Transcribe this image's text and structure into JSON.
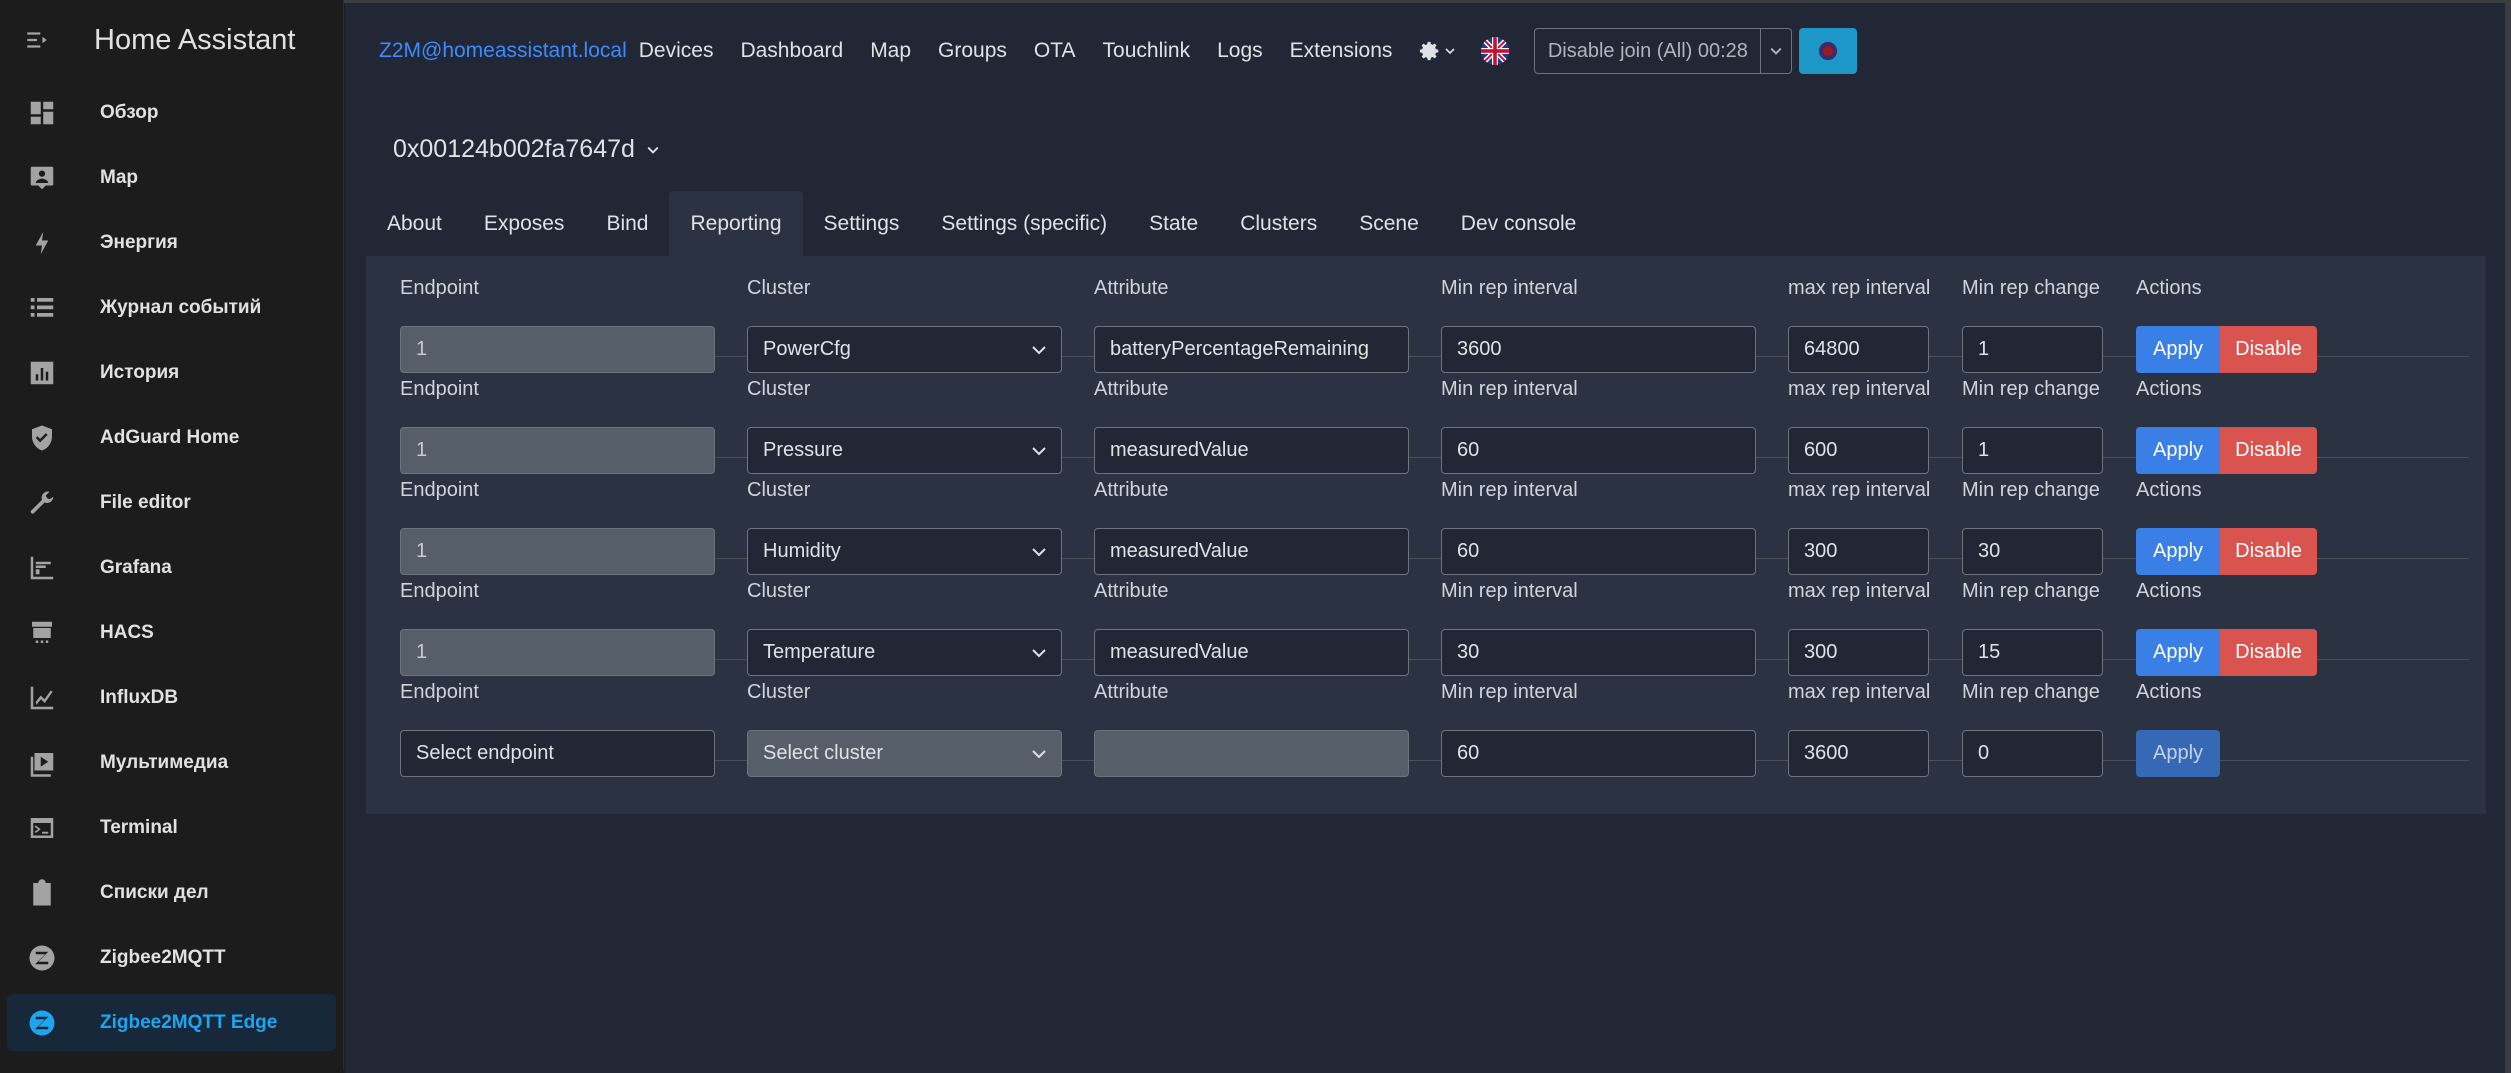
{
  "sidebar": {
    "title": "Home Assistant",
    "items": [
      {
        "label": "Обзор",
        "icon": "dashboard-icon"
      },
      {
        "label": "Map",
        "icon": "map-icon"
      },
      {
        "label": "Энергия",
        "icon": "lightning-icon"
      },
      {
        "label": "Журнал событий",
        "icon": "logbook-icon"
      },
      {
        "label": "История",
        "icon": "history-icon"
      },
      {
        "label": "AdGuard Home",
        "icon": "shield-icon"
      },
      {
        "label": "File editor",
        "icon": "wrench-icon"
      },
      {
        "label": "Grafana",
        "icon": "grafana-icon"
      },
      {
        "label": "HACS",
        "icon": "hacs-icon"
      },
      {
        "label": "InfluxDB",
        "icon": "chart-line-icon"
      },
      {
        "label": "Мультимедиа",
        "icon": "media-icon"
      },
      {
        "label": "Terminal",
        "icon": "terminal-icon"
      },
      {
        "label": "Списки дел",
        "icon": "todo-icon"
      },
      {
        "label": "Zigbee2MQTT",
        "icon": "zigbee-icon"
      },
      {
        "label": "Zigbee2MQTT Edge",
        "icon": "zigbee-icon",
        "active": true
      }
    ]
  },
  "topnav": {
    "brand": "Z2M@homeassistant.local",
    "links": [
      "Devices",
      "Dashboard",
      "Map",
      "Groups",
      "OTA",
      "Touchlink",
      "Logs",
      "Extensions"
    ],
    "join_label": "Disable join (All) 00:28"
  },
  "device": {
    "title": "0x00124b002fa7647d"
  },
  "tabs": [
    "About",
    "Exposes",
    "Bind",
    "Reporting",
    "Settings",
    "Settings (specific)",
    "State",
    "Clusters",
    "Scene",
    "Dev console"
  ],
  "active_tab": "Reporting",
  "labels": {
    "endpoint": "Endpoint",
    "cluster": "Cluster",
    "attribute": "Attribute",
    "min_rep_interval": "Min rep interval",
    "max_rep_interval": "max rep interval",
    "min_rep_change": "Min rep change",
    "actions": "Actions",
    "apply": "Apply",
    "disable": "Disable"
  },
  "rows": [
    {
      "endpoint": "1",
      "cluster": "PowerCfg",
      "attribute": "batteryPercentageRemaining",
      "min": "3600",
      "max": "64800",
      "change": "1"
    },
    {
      "endpoint": "1",
      "cluster": "Pressure",
      "attribute": "measuredValue",
      "min": "60",
      "max": "600",
      "change": "1"
    },
    {
      "endpoint": "1",
      "cluster": "Humidity",
      "attribute": "measuredValue",
      "min": "60",
      "max": "300",
      "change": "30"
    },
    {
      "endpoint": "1",
      "cluster": "Temperature",
      "attribute": "measuredValue",
      "min": "30",
      "max": "300",
      "change": "15"
    }
  ],
  "new_row": {
    "endpoint_placeholder": "Select endpoint",
    "cluster_placeholder": "Select cluster",
    "min": "60",
    "max": "3600",
    "change": "0"
  }
}
